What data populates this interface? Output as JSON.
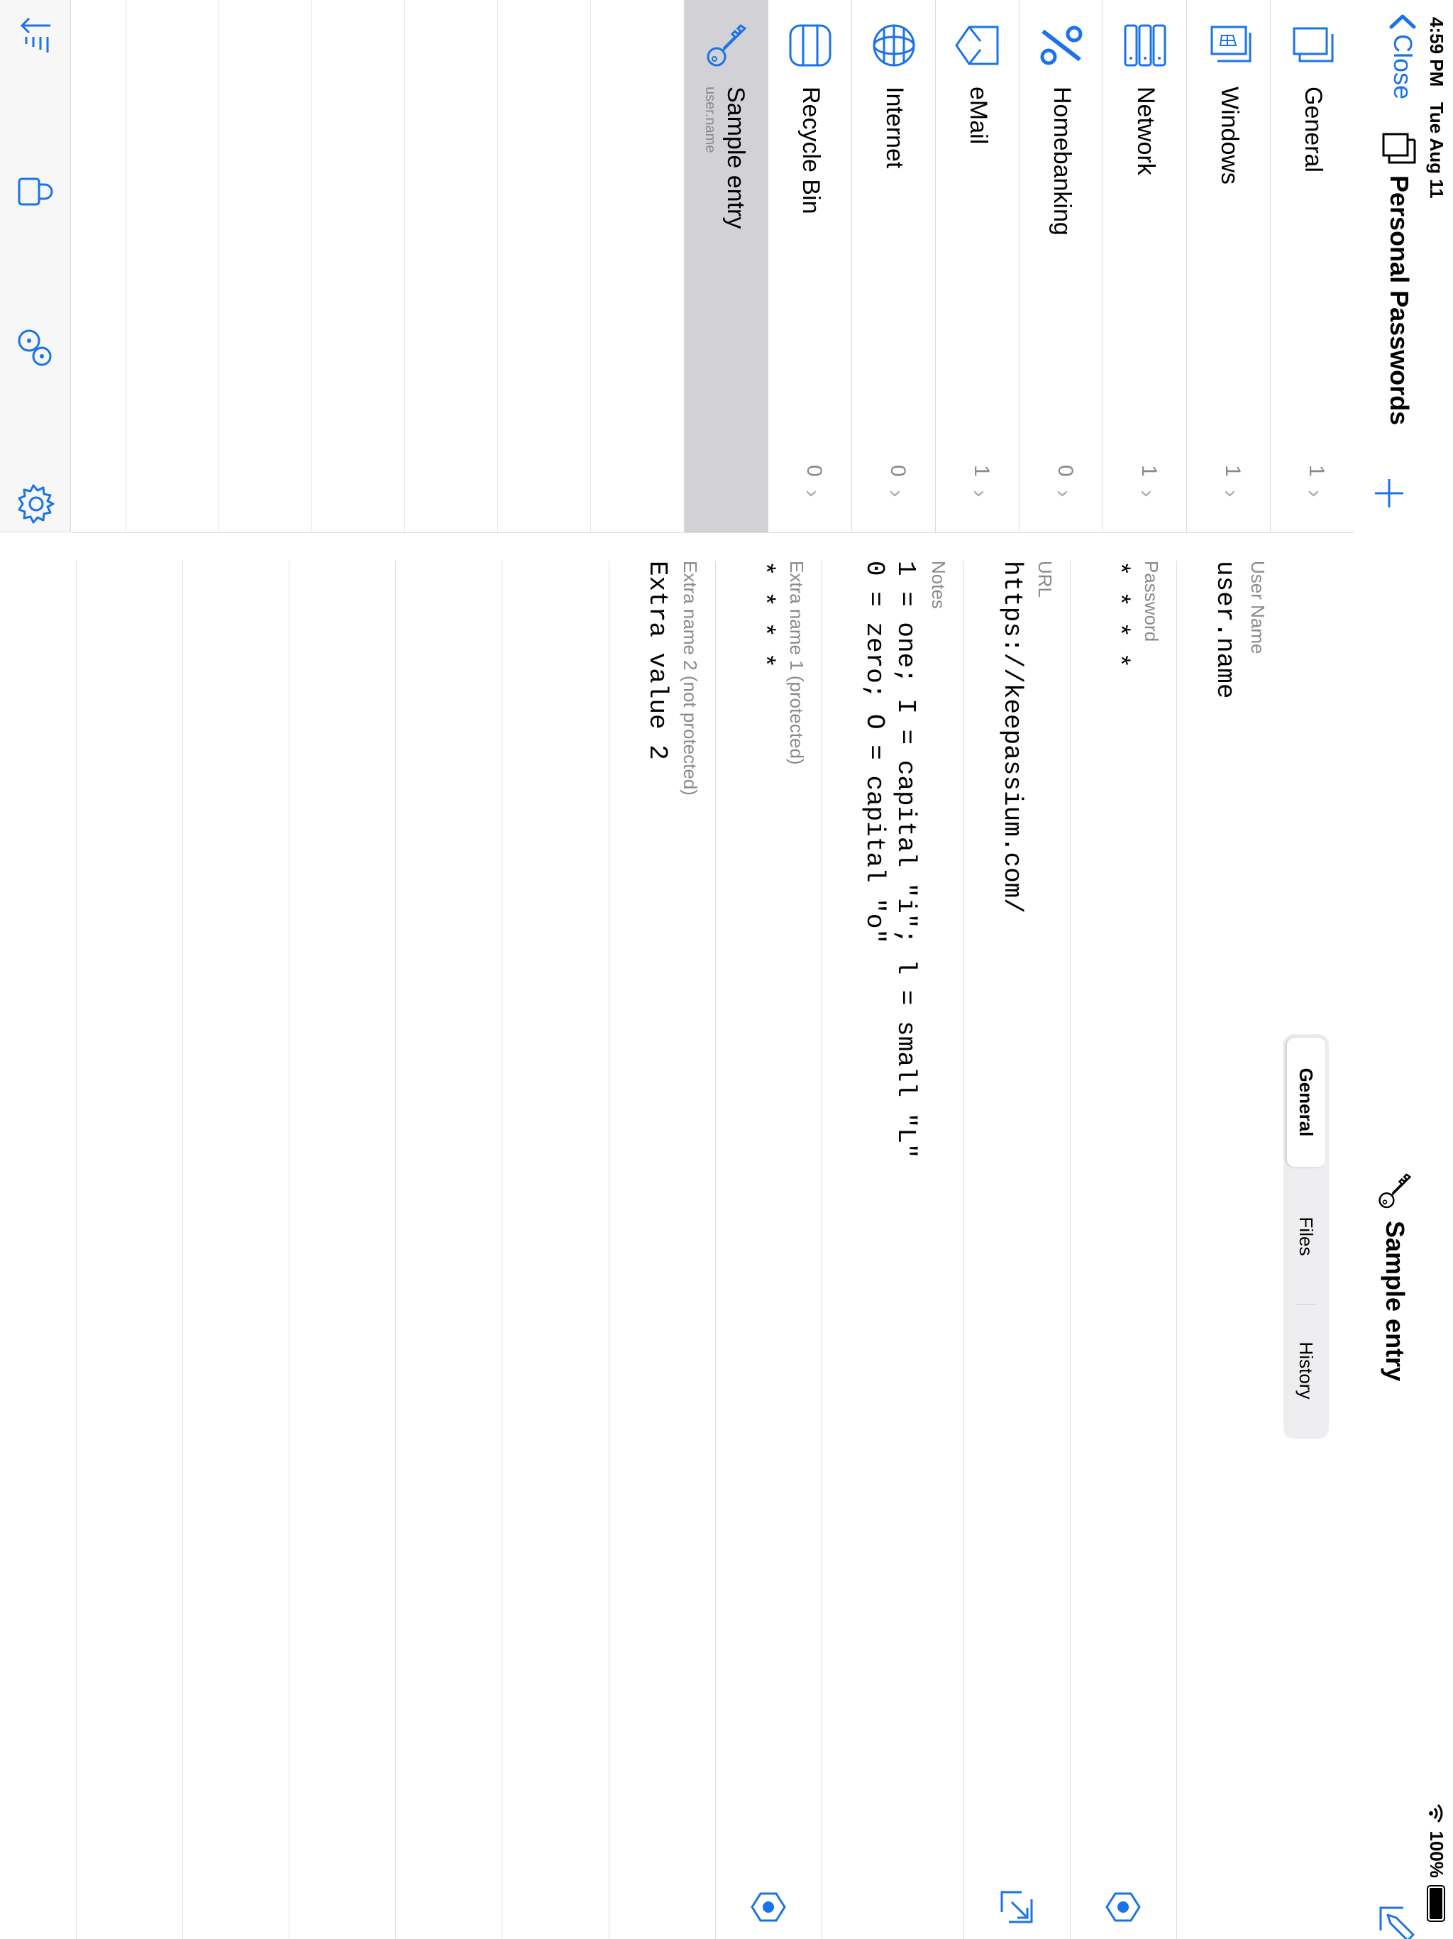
{
  "status": {
    "time": "4:59 PM",
    "date": "Tue Aug 11",
    "battery": "100%"
  },
  "nav": {
    "close_label": "Close",
    "database_title": "Personal Passwords",
    "add_icon": "plus-icon"
  },
  "groups": [
    {
      "name": "General",
      "count": "1",
      "icon": "folder-icon"
    },
    {
      "name": "Windows",
      "count": "1",
      "icon": "windows-icon"
    },
    {
      "name": "Network",
      "count": "1",
      "icon": "network-icon"
    },
    {
      "name": "Homebanking",
      "count": "0",
      "icon": "percent-icon"
    },
    {
      "name": "eMail",
      "count": "1",
      "icon": "mail-icon"
    },
    {
      "name": "Internet",
      "count": "0",
      "icon": "globe-icon"
    },
    {
      "name": "Recycle Bin",
      "count": "0",
      "icon": "recycle-bin-icon"
    }
  ],
  "entries": [
    {
      "title": "Sample entry",
      "subtitle": "user.name",
      "icon": "key-icon",
      "selected": true
    }
  ],
  "toolbar": {
    "items": [
      "sort-icon",
      "lock-icon",
      "password-generator-icon",
      "settings-icon"
    ]
  },
  "detail": {
    "title": "Sample entry",
    "tabs": {
      "general": "General",
      "files": "Files",
      "history": "History",
      "active": "General"
    },
    "fields": [
      {
        "name": "User Name",
        "value": "user.name"
      },
      {
        "name": "Password",
        "value": "* * * *",
        "action": "eye-icon"
      },
      {
        "name": "URL",
        "value": "https://keepassium.com/",
        "action": "open-url-icon"
      },
      {
        "name": "Notes",
        "value": "1 = one; I = capital \"i\"; l = small \"L\"\n0 = zero; O = capital \"o\""
      },
      {
        "name": "Extra name 1 (protected)",
        "value": "* * * *",
        "action": "eye-icon"
      },
      {
        "name": "Extra name 2 (not protected)",
        "value": "Extra value 2"
      }
    ]
  },
  "colors": {
    "accent": "#1a73e8",
    "selected_row": "#d1d1d6",
    "secondary_text": "#8a8a8e"
  }
}
